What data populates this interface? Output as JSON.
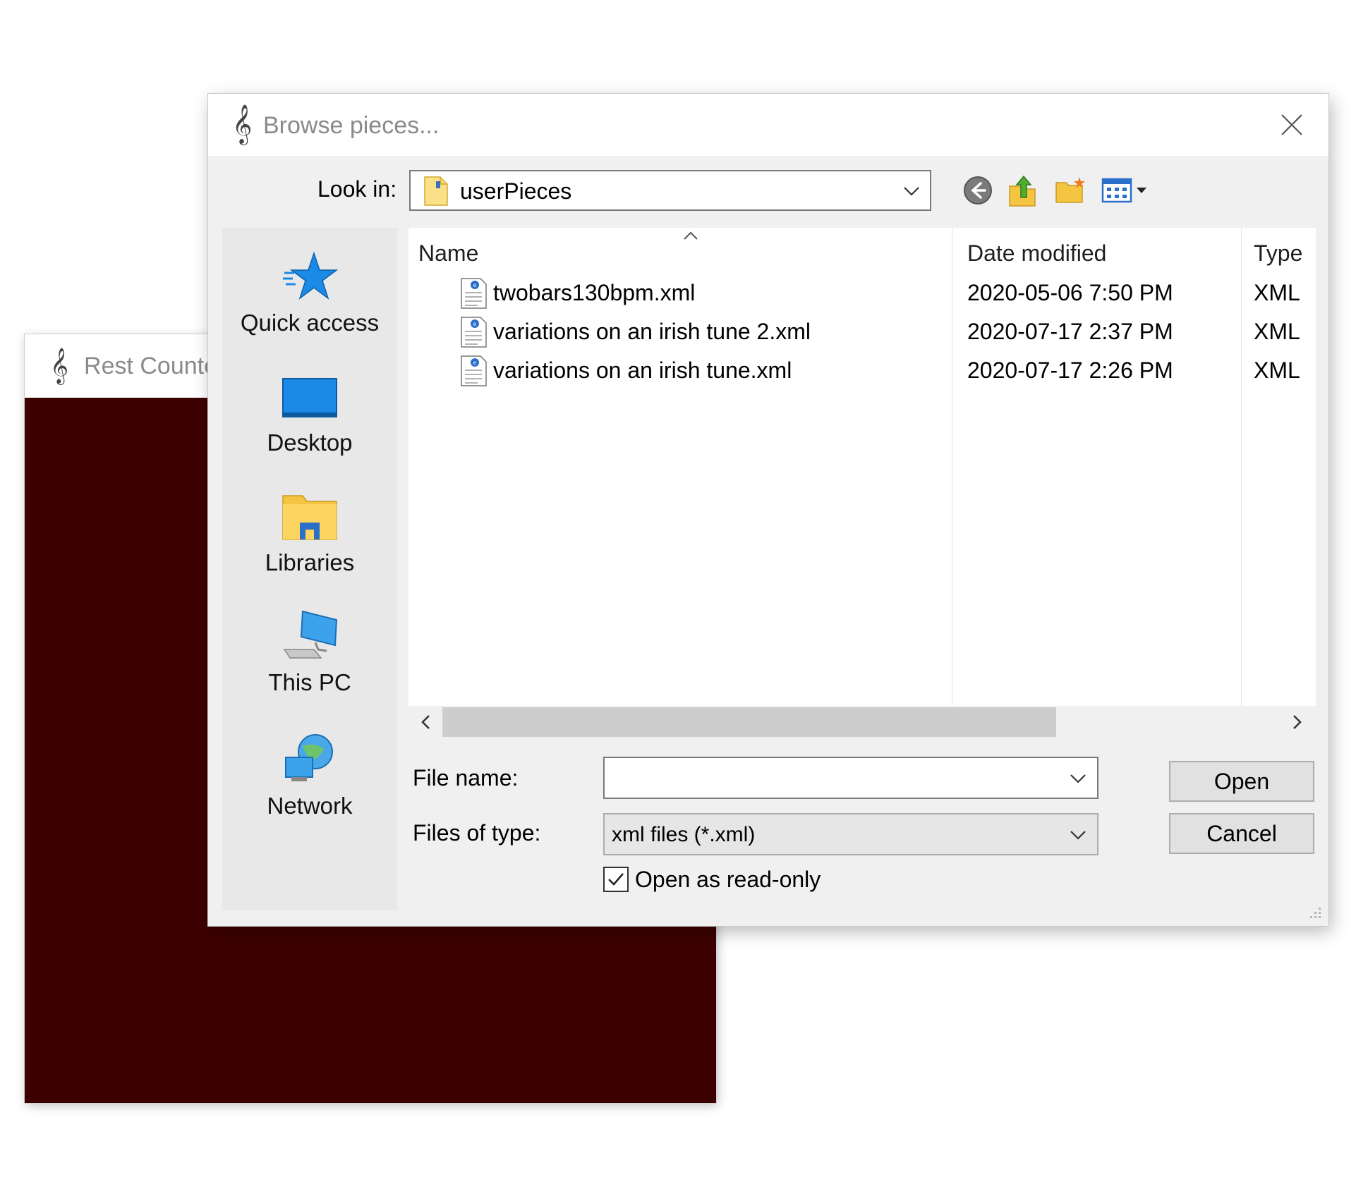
{
  "background_window": {
    "title": "Rest Counte"
  },
  "dialog": {
    "title": "Browse pieces...",
    "look_in": {
      "label": "Look in:",
      "value": "userPieces"
    },
    "toolbar": {
      "back_icon": "back-arrow-icon",
      "up_icon": "up-folder-icon",
      "new_folder_icon": "new-folder-icon",
      "view_icon": "view-menu-icon"
    },
    "places": [
      {
        "label": "Quick access",
        "icon": "quick-access-star-icon"
      },
      {
        "label": "Desktop",
        "icon": "desktop-icon"
      },
      {
        "label": "Libraries",
        "icon": "libraries-icon"
      },
      {
        "label": "This PC",
        "icon": "this-pc-icon"
      },
      {
        "label": "Network",
        "icon": "network-icon"
      }
    ],
    "columns": {
      "name": "Name",
      "date": "Date modified",
      "type": "Type"
    },
    "files": [
      {
        "name": "twobars130bpm.xml",
        "date": "2020-05-06 7:50 PM",
        "type": "XML"
      },
      {
        "name": "variations on an irish tune 2.xml",
        "date": "2020-07-17 2:37 PM",
        "type": "XML"
      },
      {
        "name": "variations on an irish tune.xml",
        "date": "2020-07-17 2:26 PM",
        "type": "XML"
      }
    ],
    "file_name": {
      "label": "File name:",
      "value": ""
    },
    "file_type": {
      "label": "Files of type:",
      "value": "xml files (*.xml)"
    },
    "read_only": {
      "label": "Open as read-only",
      "checked": true
    },
    "buttons": {
      "open": "Open",
      "cancel": "Cancel"
    }
  },
  "colors": {
    "dark_red_canvas": "#3d0000",
    "dialog_bg": "#f0f0f0",
    "accent_blue": "#1a8ae6",
    "folder_yellow": "#f5c542"
  }
}
